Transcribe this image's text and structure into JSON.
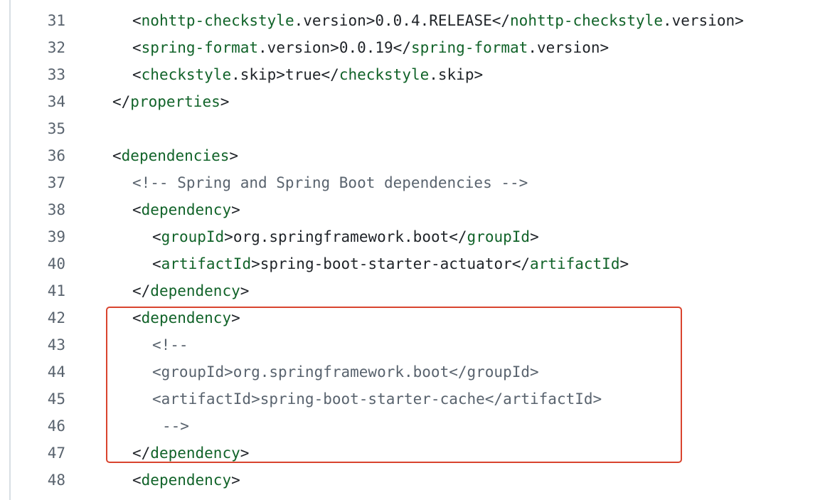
{
  "lines": [
    {
      "num": "31",
      "indent": 2,
      "tokens": [
        {
          "t": "<",
          "c": "punct"
        },
        {
          "t": "nohttp-checkstyle",
          "c": "tag"
        },
        {
          "t": ".version>0.0.4.RELEASE</",
          "c": "punct"
        },
        {
          "t": "nohttp-checkstyle",
          "c": "tag"
        },
        {
          "t": ".version>",
          "c": "punct"
        }
      ]
    },
    {
      "num": "32",
      "indent": 2,
      "tokens": [
        {
          "t": "<",
          "c": "punct"
        },
        {
          "t": "spring-format",
          "c": "tag"
        },
        {
          "t": ".version>0.0.19</",
          "c": "punct"
        },
        {
          "t": "spring-format",
          "c": "tag"
        },
        {
          "t": ".version>",
          "c": "punct"
        }
      ]
    },
    {
      "num": "33",
      "indent": 2,
      "tokens": [
        {
          "t": "<",
          "c": "punct"
        },
        {
          "t": "checkstyle",
          "c": "tag"
        },
        {
          "t": ".skip>true</",
          "c": "punct"
        },
        {
          "t": "checkstyle",
          "c": "tag"
        },
        {
          "t": ".skip>",
          "c": "punct"
        }
      ]
    },
    {
      "num": "34",
      "indent": 0,
      "tokens": [
        {
          "t": "</",
          "c": "punct"
        },
        {
          "t": "properties",
          "c": "tag"
        },
        {
          "t": ">",
          "c": "punct"
        }
      ]
    },
    {
      "num": "35",
      "indent": 0,
      "tokens": []
    },
    {
      "num": "36",
      "indent": 0,
      "tokens": [
        {
          "t": "<",
          "c": "punct"
        },
        {
          "t": "dependencies",
          "c": "tag"
        },
        {
          "t": ">",
          "c": "punct"
        }
      ]
    },
    {
      "num": "37",
      "indent": 2,
      "tokens": [
        {
          "t": "<!-- Spring and Spring Boot dependencies -->",
          "c": "comment"
        }
      ]
    },
    {
      "num": "38",
      "indent": 2,
      "tokens": [
        {
          "t": "<",
          "c": "punct"
        },
        {
          "t": "dependency",
          "c": "tag"
        },
        {
          "t": ">",
          "c": "punct"
        }
      ]
    },
    {
      "num": "39",
      "indent": 4,
      "tokens": [
        {
          "t": "<",
          "c": "punct"
        },
        {
          "t": "groupId",
          "c": "tag"
        },
        {
          "t": ">org.springframework.boot</",
          "c": "punct"
        },
        {
          "t": "groupId",
          "c": "tag"
        },
        {
          "t": ">",
          "c": "punct"
        }
      ]
    },
    {
      "num": "40",
      "indent": 4,
      "tokens": [
        {
          "t": "<",
          "c": "punct"
        },
        {
          "t": "artifactId",
          "c": "tag"
        },
        {
          "t": ">spring-boot-starter-actuator</",
          "c": "punct"
        },
        {
          "t": "artifactId",
          "c": "tag"
        },
        {
          "t": ">",
          "c": "punct"
        }
      ]
    },
    {
      "num": "41",
      "indent": 2,
      "tokens": [
        {
          "t": "</",
          "c": "punct"
        },
        {
          "t": "dependency",
          "c": "tag"
        },
        {
          "t": ">",
          "c": "punct"
        }
      ]
    },
    {
      "num": "42",
      "indent": 2,
      "tokens": [
        {
          "t": "<",
          "c": "punct"
        },
        {
          "t": "dependency",
          "c": "tag"
        },
        {
          "t": ">",
          "c": "punct"
        }
      ]
    },
    {
      "num": "43",
      "indent": 4,
      "tokens": [
        {
          "t": "<!--",
          "c": "comment"
        }
      ]
    },
    {
      "num": "44",
      "indent": 4,
      "tokens": [
        {
          "t": "<groupId>org.springframework.boot</groupId>",
          "c": "comment"
        }
      ]
    },
    {
      "num": "45",
      "indent": 4,
      "tokens": [
        {
          "t": "<artifactId>spring-boot-starter-cache</artifactId>",
          "c": "comment"
        }
      ]
    },
    {
      "num": "46",
      "indent": 5,
      "tokens": [
        {
          "t": "-->",
          "c": "comment"
        }
      ]
    },
    {
      "num": "47",
      "indent": 2,
      "tokens": [
        {
          "t": "</",
          "c": "punct"
        },
        {
          "t": "dependency",
          "c": "tag"
        },
        {
          "t": ">",
          "c": "punct"
        }
      ]
    },
    {
      "num": "48",
      "indent": 2,
      "tokens": [
        {
          "t": "<",
          "c": "punct"
        },
        {
          "t": "dependency",
          "c": "tag"
        },
        {
          "t": ">",
          "c": "punct"
        }
      ]
    }
  ],
  "colors": {
    "tag": "#116329",
    "text": "#1f2328",
    "comment": "#59636e",
    "line_number": "#59636e",
    "highlight_border": "#d9442e",
    "gutter_border": "#d8dee4"
  }
}
